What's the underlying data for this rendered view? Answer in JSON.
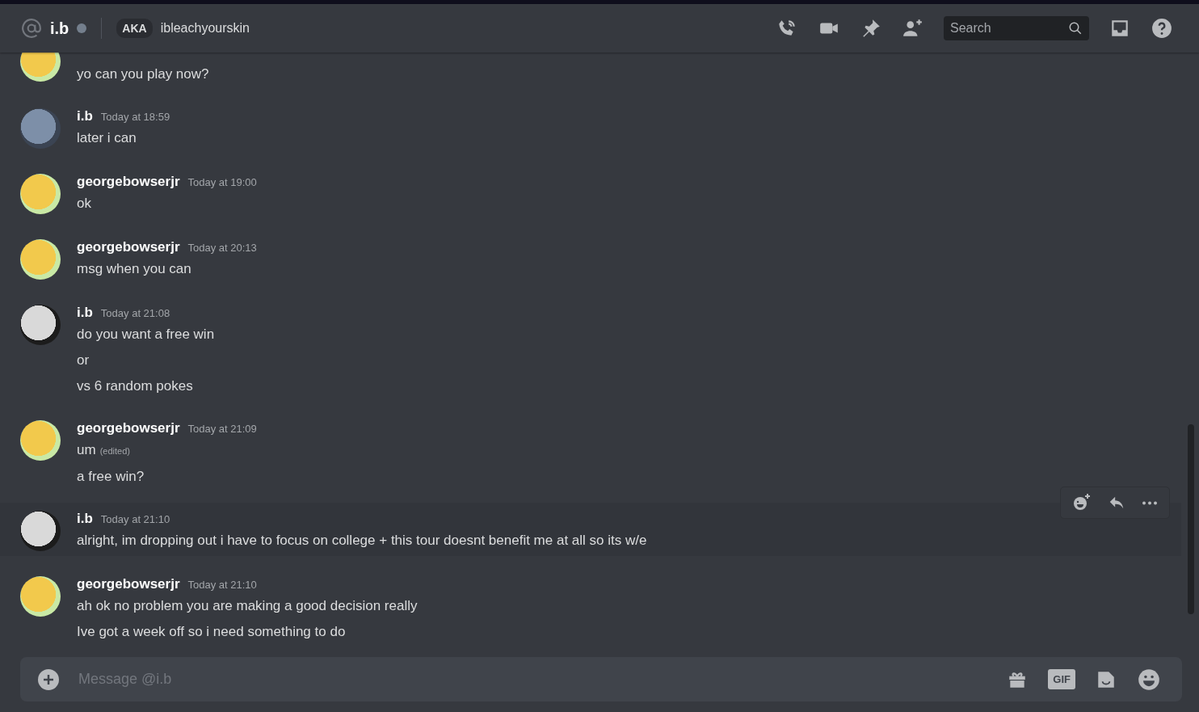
{
  "header": {
    "name": "i.b",
    "online": false,
    "aka_label": "AKA",
    "aka_name": "ibleachyourskin",
    "search": {
      "placeholder": "Search"
    }
  },
  "messages": [
    {
      "kind": "pokemon",
      "lines": [
        {
          "text": "yo can you play now?"
        }
      ],
      "hovered": false
    },
    {
      "kind": "photo",
      "author": "i.b",
      "time": "Today at 18:59",
      "lines": [
        {
          "text": "later i can"
        }
      ],
      "hovered": false
    },
    {
      "kind": "pokemon",
      "author": "georgebowserjr",
      "time": "Today at 19:00",
      "lines": [
        {
          "text": "ok"
        }
      ],
      "hovered": false
    },
    {
      "kind": "pokemon",
      "author": "georgebowserjr",
      "time": "Today at 20:13",
      "lines": [
        {
          "text": "msg when you can"
        }
      ],
      "hovered": false
    },
    {
      "kind": "anime",
      "author": "i.b",
      "time": "Today at 21:08",
      "lines": [
        {
          "text": "do you want a free win"
        },
        {
          "text": "or"
        },
        {
          "text": "vs 6 random pokes"
        }
      ],
      "hovered": false
    },
    {
      "kind": "pokemon",
      "author": "georgebowserjr",
      "time": "Today at 21:09",
      "lines": [
        {
          "text": "um",
          "edited": "(edited)"
        },
        {
          "text": "a free win?"
        }
      ],
      "hovered": false
    },
    {
      "kind": "anime",
      "author": "i.b",
      "time": "Today at 21:10",
      "lines": [
        {
          "text": "alright, im dropping out i have to focus on college + this tour doesnt benefit me at all so its w/e"
        }
      ],
      "hovered": true
    },
    {
      "kind": "pokemon",
      "author": "georgebowserjr",
      "time": "Today at 21:10",
      "lines": [
        {
          "text": "ah ok no problem you are making a good decision really"
        },
        {
          "text": "Ive got a week off so i need something to do"
        }
      ],
      "hovered": false
    }
  ],
  "composer": {
    "placeholder": "Message @i.b",
    "gif_label": "GIF"
  }
}
